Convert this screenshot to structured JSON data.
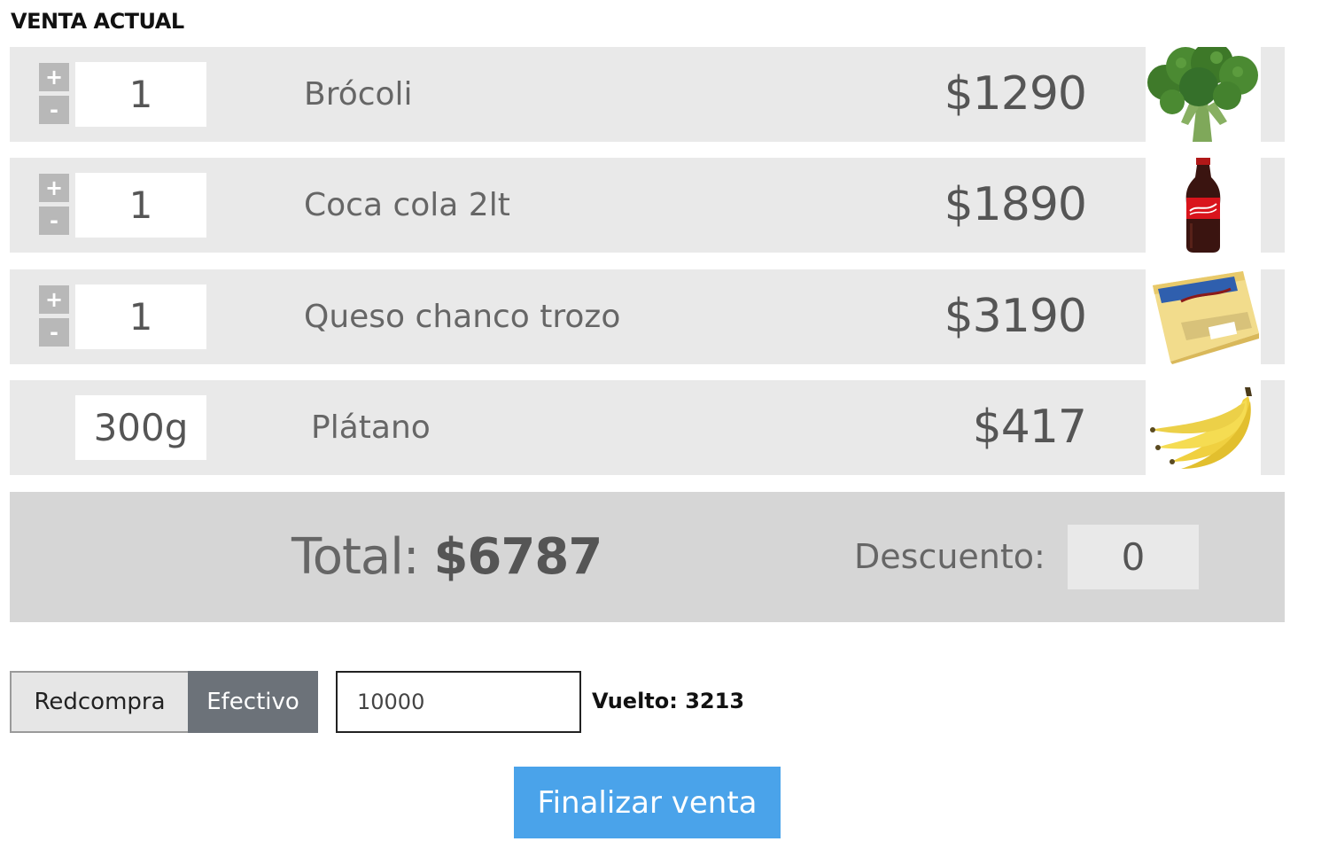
{
  "header": {
    "title": "VENTA ACTUAL"
  },
  "items": [
    {
      "qty": "1",
      "name": "Brócoli",
      "price": "$1290",
      "image": "broccoli-image",
      "has_stepper": true
    },
    {
      "qty": "1",
      "name": "Coca cola 2lt",
      "price": "$1890",
      "image": "coca-cola-bottle-image",
      "has_stepper": true
    },
    {
      "qty": "1",
      "name": "Queso chanco trozo",
      "price": "$3190",
      "image": "chanco-cheese-image",
      "has_stepper": true
    },
    {
      "qty": "300g",
      "name": "Plátano",
      "price": "$417",
      "image": "banana-image",
      "has_stepper": false
    }
  ],
  "stepper": {
    "plus": "+",
    "minus": "-"
  },
  "summary": {
    "total_label": "Total:",
    "total_value": "$6787",
    "discount_label": "Descuento:",
    "discount_value": "0"
  },
  "payment": {
    "method_1": "Redcompra",
    "method_2": "Efectivo",
    "selected": "Efectivo",
    "cash_value": "10000",
    "change_text": "Vuelto: 3213"
  },
  "actions": {
    "finish_label": "Finalizar venta"
  },
  "colors": {
    "accent": "#4aa3ea",
    "selected_method": "#6c7279",
    "row_bg": "#e9e9e9",
    "total_bg": "#d6d6d6"
  }
}
